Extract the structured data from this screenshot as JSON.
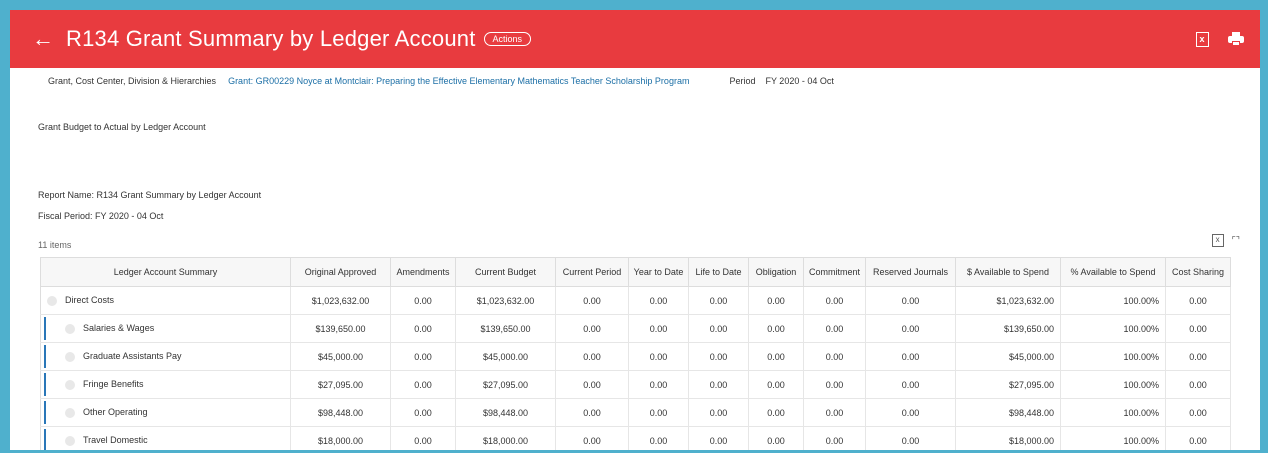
{
  "header": {
    "title": "R134 Grant Summary by Ledger Account",
    "actions_label": "Actions",
    "excel_icon": "excel-export-icon",
    "print_icon": "printer-icon"
  },
  "filters": {
    "grant_label": "Grant, Cost Center, Division & Hierarchies",
    "grant_value": "Grant: GR00229 Noyce at Montclair: Preparing the Effective Elementary Mathematics Teacher Scholarship Program",
    "period_label": "Period",
    "period_value": "FY 2020 - 04 Oct"
  },
  "subtitle": "Grant Budget to Actual by Ledger Account",
  "report_name": "Report Name: R134 Grant Summary by Ledger Account",
  "fiscal_period": "Fiscal Period: FY 2020 - 04 Oct",
  "items_count": "11 items",
  "table": {
    "columns": [
      "Ledger Account Summary",
      "Original Approved",
      "Amendments",
      "Current Budget",
      "Current Period",
      "Year to Date",
      "Life to Date",
      "Obligation",
      "Commitment",
      "Reserved Journals",
      "$ Available to Spend",
      "% Available to Spend",
      "Cost Sharing"
    ],
    "rows": [
      {
        "name": "Direct Costs",
        "original": "$1,023,632.00",
        "amendments": "0.00",
        "current_budget": "$1,023,632.00",
        "current_period": "0.00",
        "ytd": "0.00",
        "ltd": "0.00",
        "obligation": "0.00",
        "commitment": "0.00",
        "reserved": "0.00",
        "avail": "$1,023,632.00",
        "pct": "100.00%",
        "cost_sharing": "0.00"
      },
      {
        "name": "Salaries & Wages",
        "original": "$139,650.00",
        "amendments": "0.00",
        "current_budget": "$139,650.00",
        "current_period": "0.00",
        "ytd": "0.00",
        "ltd": "0.00",
        "obligation": "0.00",
        "commitment": "0.00",
        "reserved": "0.00",
        "avail": "$139,650.00",
        "pct": "100.00%",
        "cost_sharing": "0.00"
      },
      {
        "name": "Graduate Assistants Pay",
        "original": "$45,000.00",
        "amendments": "0.00",
        "current_budget": "$45,000.00",
        "current_period": "0.00",
        "ytd": "0.00",
        "ltd": "0.00",
        "obligation": "0.00",
        "commitment": "0.00",
        "reserved": "0.00",
        "avail": "$45,000.00",
        "pct": "100.00%",
        "cost_sharing": "0.00"
      },
      {
        "name": "Fringe Benefits",
        "original": "$27,095.00",
        "amendments": "0.00",
        "current_budget": "$27,095.00",
        "current_period": "0.00",
        "ytd": "0.00",
        "ltd": "0.00",
        "obligation": "0.00",
        "commitment": "0.00",
        "reserved": "0.00",
        "avail": "$27,095.00",
        "pct": "100.00%",
        "cost_sharing": "0.00"
      },
      {
        "name": "Other Operating",
        "original": "$98,448.00",
        "amendments": "0.00",
        "current_budget": "$98,448.00",
        "current_period": "0.00",
        "ytd": "0.00",
        "ltd": "0.00",
        "obligation": "0.00",
        "commitment": "0.00",
        "reserved": "0.00",
        "avail": "$98,448.00",
        "pct": "100.00%",
        "cost_sharing": "0.00"
      },
      {
        "name": "Travel Domestic",
        "original": "$18,000.00",
        "amendments": "0.00",
        "current_budget": "$18,000.00",
        "current_period": "0.00",
        "ytd": "0.00",
        "ltd": "0.00",
        "obligation": "0.00",
        "commitment": "0.00",
        "reserved": "0.00",
        "avail": "$18,000.00",
        "pct": "100.00%",
        "cost_sharing": "0.00"
      }
    ]
  }
}
